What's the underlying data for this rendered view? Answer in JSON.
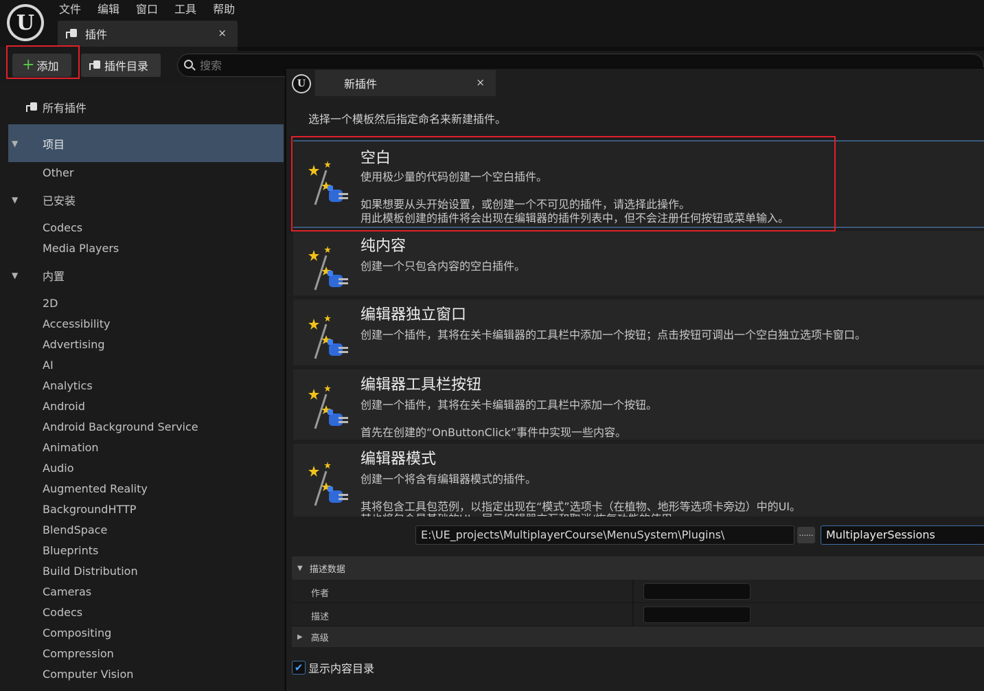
{
  "app": {
    "logo": "ue-logo",
    "logo_text": "U"
  },
  "menubar": [
    "文件",
    "编辑",
    "窗口",
    "工具",
    "帮助"
  ],
  "doc_tab": {
    "label": "插件",
    "close": "×"
  },
  "toolbar": {
    "add_label": "添加",
    "catalog_label": "插件目录"
  },
  "search": {
    "placeholder": "搜索"
  },
  "sidebar": {
    "all_plugins": "所有插件",
    "categories": [
      {
        "label": "项目",
        "selected": true,
        "items": [
          "Other"
        ]
      },
      {
        "label": "已安装",
        "items": [
          "Codecs",
          "Media Players"
        ]
      },
      {
        "label": "内置",
        "items": [
          "2D",
          "Accessibility",
          "Advertising",
          "AI",
          "Analytics",
          "Android",
          "Android Background Service",
          "Animation",
          "Audio",
          "Augmented Reality",
          "BackgroundHTTP",
          "BlendSpace",
          "Blueprints",
          "Build Distribution",
          "Cameras",
          "Codecs",
          "Compositing",
          "Compression",
          "Computer Vision"
        ]
      }
    ]
  },
  "dialog": {
    "tab_label": "新插件",
    "close": "×",
    "instruction": "选择一个模板然后指定命名来新建插件。",
    "templates": [
      {
        "title": "空白",
        "lines": [
          "使用极少量的代码创建一个空白插件。",
          "",
          "如果想要从头开始设置，或创建一个不可见的插件，请选择此操作。",
          "用此模板创建的插件将会出现在编辑器的插件列表中，但不会注册任何按钮或菜单输入。"
        ]
      },
      {
        "title": "纯内容",
        "lines": [
          "创建一个只包含内容的空白插件。"
        ]
      },
      {
        "title": "编辑器独立窗口",
        "lines": [
          "创建一个插件，其将在关卡编辑器的工具栏中添加一个按钮；点击按钮可调出一个空白独立选项卡窗口。"
        ]
      },
      {
        "title": "编辑器工具栏按钮",
        "lines": [
          "创建一个插件，其将在关卡编辑器的工具栏中添加一个按钮。",
          "",
          "首先在创建的“OnButtonClick”事件中实现一些内容。"
        ]
      },
      {
        "title": "编辑器模式",
        "lines": [
          "创建一个将含有编辑器模式的插件。",
          "",
          "其将包含工具包范例，以指定出现在“模式”选项卡（在植物、地形等选项卡旁边）中的UI。",
          "其也将包含最基础的UI，展示编辑器交互和取消/恢复功能的使用。"
        ]
      }
    ],
    "path": "E:\\UE_projects\\MultiplayerCourse\\MenuSystem\\Plugins\\",
    "browse_label": "......",
    "plugin_name": "MultiplayerSessions",
    "details": {
      "header": "描述数据",
      "author_label": "作者",
      "author_value": "",
      "description_label": "描述",
      "description_value": "",
      "advanced_label": "高级"
    },
    "show_content_label": "显示内容目录",
    "show_content_checked": true
  },
  "colors": {
    "selection": "#3d5066",
    "highlight": "#e0202a",
    "add_plus": "#58c94a",
    "focus": "#3f6fa6"
  }
}
